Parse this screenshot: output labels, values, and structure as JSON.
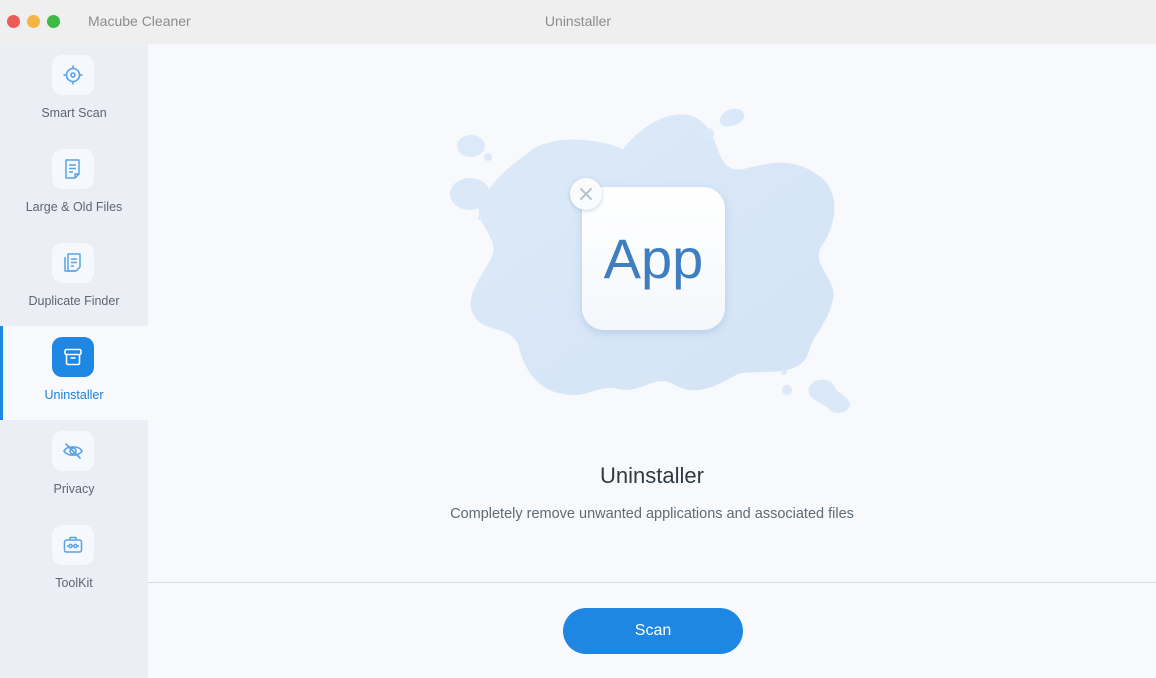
{
  "window": {
    "app_name": "Macube Cleaner",
    "title": "Uninstaller"
  },
  "sidebar": {
    "items": [
      {
        "label": "Smart Scan",
        "icon": "target-icon",
        "active": false
      },
      {
        "label": "Large & Old Files",
        "icon": "document-icon",
        "active": false
      },
      {
        "label": "Duplicate Finder",
        "icon": "duplicate-documents-icon",
        "active": false
      },
      {
        "label": "Uninstaller",
        "icon": "box-icon",
        "active": true
      },
      {
        "label": "Privacy",
        "icon": "eye-slash-icon",
        "active": false
      },
      {
        "label": "ToolKit",
        "icon": "toolbox-icon",
        "active": false
      }
    ]
  },
  "main": {
    "illustration": {
      "app_label": "App",
      "badge_icon": "close-icon"
    },
    "heading": "Uninstaller",
    "description": "Completely remove unwanted applications and associated files",
    "scan_button": "Scan"
  },
  "colors": {
    "accent": "#1e86e3",
    "sidebar_bg": "#ebeef5",
    "main_bg": "#f7f9fc",
    "titlebar_bg": "#efefef",
    "splash": "#d8e7f7"
  }
}
